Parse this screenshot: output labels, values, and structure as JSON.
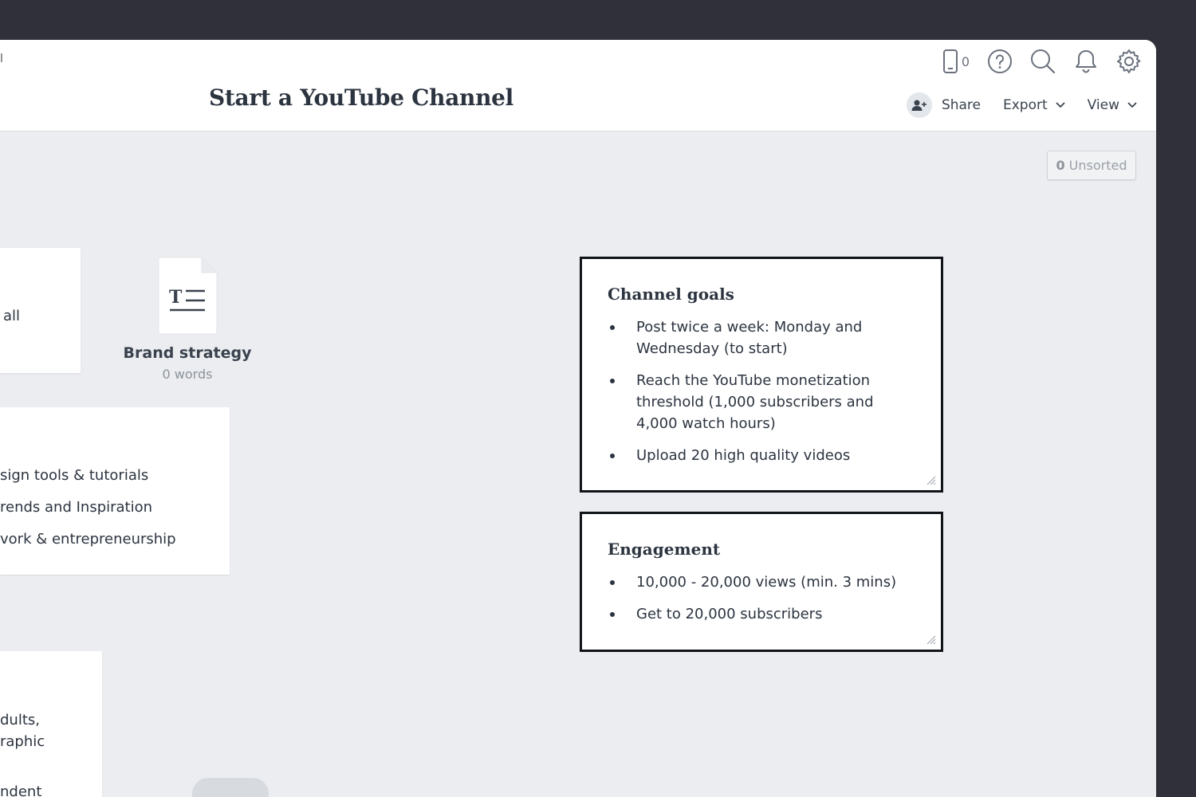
{
  "header": {
    "breadcrumb_fragment": "l",
    "title": "Start a YouTube Channel",
    "mobile_count": "0",
    "icons": [
      "mobile-icon",
      "help-icon",
      "search-icon",
      "bell-icon",
      "gear-icon"
    ],
    "share_label": "Share",
    "export_label": "Export",
    "view_label": "View"
  },
  "canvas": {
    "unsorted_count": "0",
    "unsorted_label": "Unsorted",
    "card_top": {
      "text": "all"
    },
    "card_middle": {
      "lines": [
        "sign tools & tutorials",
        "rends and Inspiration",
        "vork & entrepreneurship"
      ]
    },
    "card_bottom": {
      "lines": [
        "dults,",
        "raphic",
        "ndent"
      ]
    },
    "document": {
      "title": "Brand strategy",
      "subtitle": "0 words"
    },
    "notes": [
      {
        "title": "Channel goals",
        "items": [
          "Post twice a week: Monday and Wednesday (to start)",
          "Reach the YouTube monetization threshold (1,000 subscribers and 4,000 watch hours)",
          "Upload 20 high quality videos"
        ]
      },
      {
        "title": "Engagement",
        "items": [
          "10,000 - 20,000 views (min. 3 mins)",
          "Get to 20,000 subscribers"
        ]
      }
    ]
  },
  "colors": {
    "outer_background": "#30303a",
    "canvas_background": "#ebedf0",
    "text": "#2c3440",
    "note_border": "#111418"
  }
}
